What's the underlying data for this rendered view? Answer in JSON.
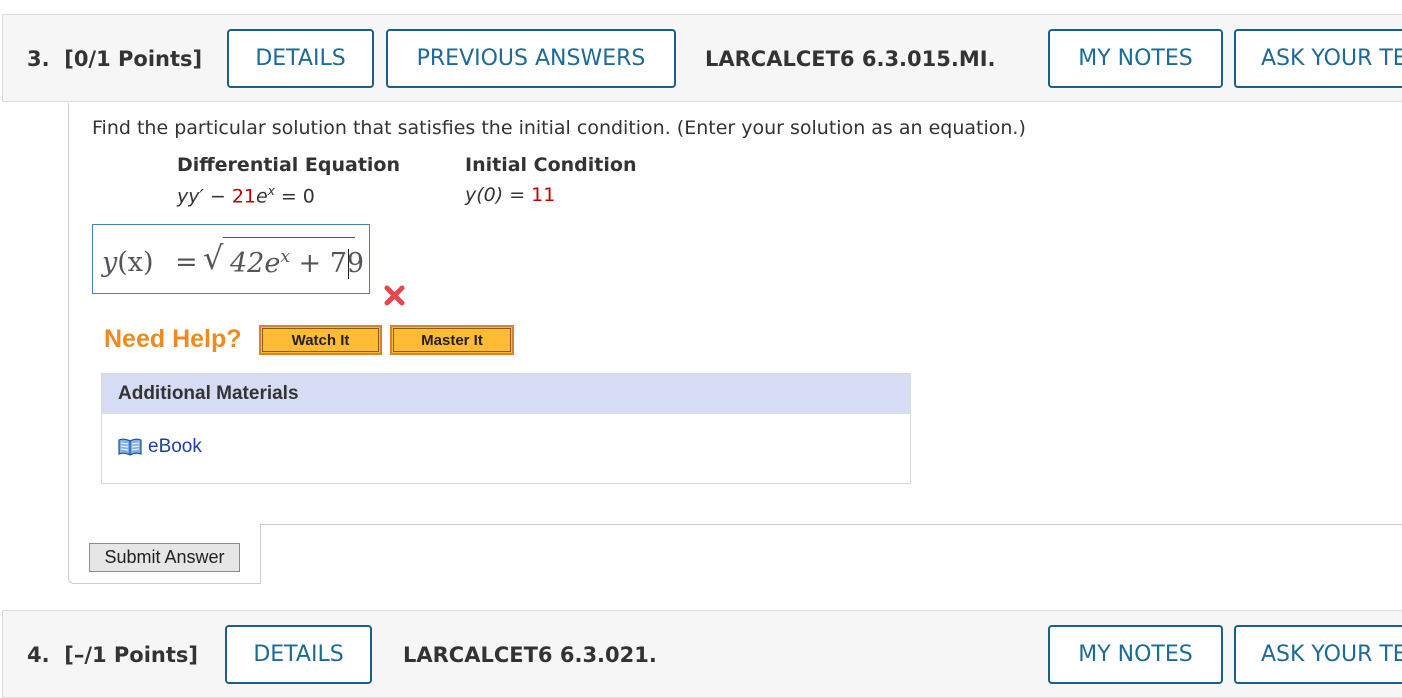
{
  "question3": {
    "number": "3.",
    "points": "[0/1 Points]",
    "details_label": "DETAILS",
    "previous_answers_label": "PREVIOUS ANSWERS",
    "code": "LARCALCET6 6.3.015.MI.",
    "my_notes_label": "MY NOTES",
    "ask_label": "ASK YOUR TE",
    "prompt": "Find the particular solution that satisfies the initial condition. (Enter your solution as an equation.)",
    "diff_eq_heading": "Differential Equation",
    "initial_cond_heading": "Initial Condition",
    "diff_eq": {
      "lhs": "yy′ − ",
      "coef": "21",
      "base": "e",
      "exp": "x",
      "rhs": " = 0"
    },
    "initial_cond": {
      "lhs": "y(0) = ",
      "value": "11"
    },
    "answer": {
      "lhs_fn": "y",
      "lhs_arg": "(x)",
      "equals": "=",
      "radicand_coef": "42e",
      "radicand_exp": "x",
      "radicand_rest": " + 79"
    },
    "result": "incorrect",
    "need_help_label": "Need Help?",
    "watch_it_label": "Watch It",
    "master_it_label": "Master It",
    "additional_materials_label": "Additional Materials",
    "ebook_label": "eBook",
    "submit_label": "Submit Answer"
  },
  "question4": {
    "number": "4.",
    "points": "[–/1 Points]",
    "details_label": "DETAILS",
    "code": "LARCALCET6 6.3.021.",
    "my_notes_label": "MY NOTES",
    "ask_label": "ASK YOUR TE"
  },
  "colors": {
    "button_border": "#1c5f85",
    "button_text": "#1c6a96",
    "red_value": "#c00000",
    "need_help": "#f08a1c",
    "help_button": "#ffbb33",
    "materials_header": "#d7dcf5",
    "link": "#1a3fa8"
  }
}
